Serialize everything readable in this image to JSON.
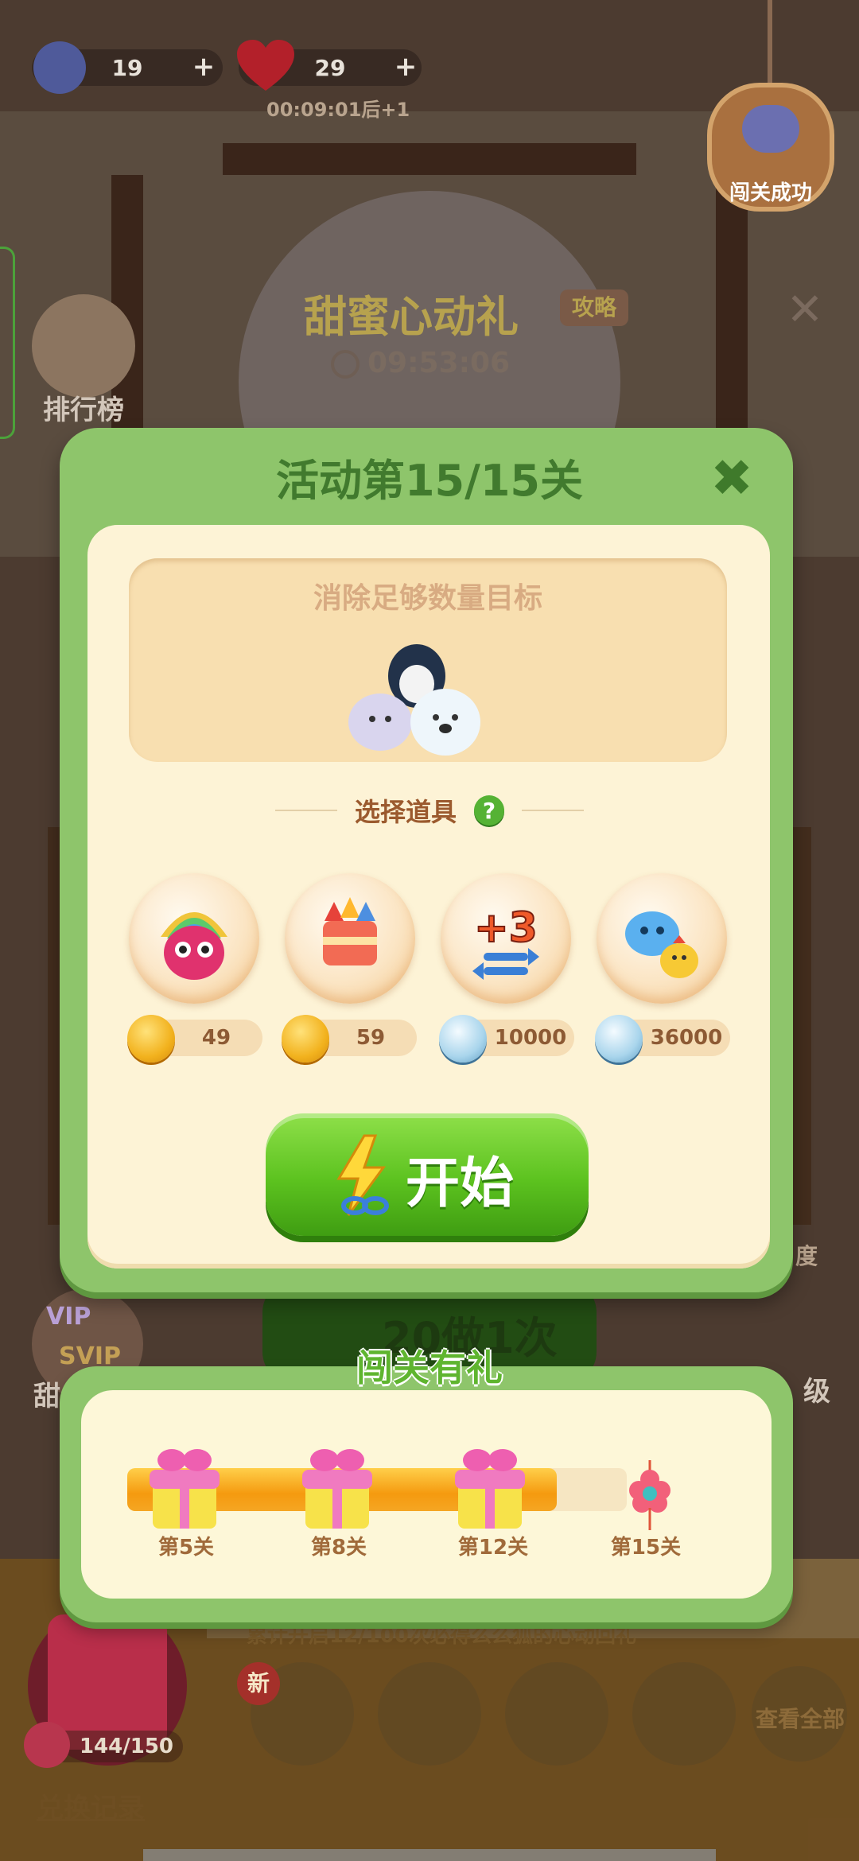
{
  "top_bar": {
    "teapot_count": "19",
    "hearts_count": "29",
    "heart_timer": "00:09:01后+1"
  },
  "corner_badge": {
    "label": "闯关成功"
  },
  "background": {
    "event_title": "甜蜜心动礼",
    "guide_tag": "攻略",
    "countdown": "09:53:06",
    "leaderboard_label": "排行榜",
    "do_once_text": "20做1次",
    "vip_labels": [
      "VIP",
      "SVIP"
    ],
    "sweet_label": "甜",
    "level_label": "级",
    "progress_hint": "度",
    "new_badge": "新",
    "view_all": "查看全部",
    "bag_count": "144/150",
    "exchange_record": "兑换记录",
    "accumulate_text": "累计开启12/100次必得么么狐的心动回礼"
  },
  "dialog": {
    "title": "活动第15/15关",
    "goal_title": "消除足够数量目标",
    "props_label": "选择道具",
    "help_symbol": "?",
    "items": [
      {
        "name": "rainbow-bird",
        "price": "49",
        "currency": "coin"
      },
      {
        "name": "firework-rocket",
        "price": "59",
        "currency": "coin"
      },
      {
        "name": "plus-3-moves",
        "price": "10000",
        "currency": "gem"
      },
      {
        "name": "pets-combo",
        "price": "36000",
        "currency": "gem"
      }
    ],
    "start_label": "开始"
  },
  "rewards": {
    "title": "闯关有礼",
    "progress_fraction": 0.86,
    "milestones": [
      "第5关",
      "第8关",
      "第12关",
      "第15关"
    ]
  },
  "colors": {
    "panel_green": "#8ec56b",
    "panel_cream": "#fdf3d6",
    "start_green": "#5cc21f",
    "title_green": "#417a2e",
    "progress_orange": "#f59a0f"
  }
}
